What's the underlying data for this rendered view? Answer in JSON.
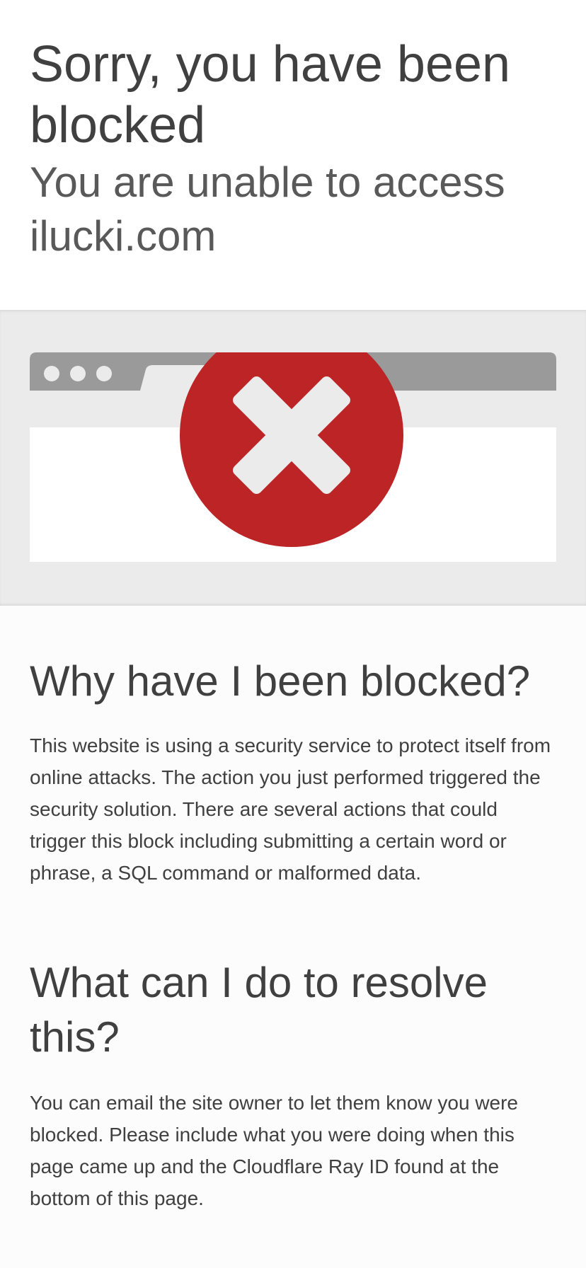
{
  "header": {
    "title": "Sorry, you have been blocked",
    "subtitle": "You are unable to access ilucki.com"
  },
  "illustration": {
    "icon": "error-x-icon",
    "colors": {
      "circle": "#bd2426",
      "browser_bar": "#9a9a9a",
      "band": "#ebebeb"
    }
  },
  "why": {
    "heading": "Why have I been blocked?",
    "text": "This website is using a security service to protect itself from online attacks. The action you just performed triggered the security solution. There are several actions that could trigger this block including submitting a certain word or phrase, a SQL command or malformed data."
  },
  "resolve": {
    "heading": "What can I do to resolve this?",
    "text": "You can email the site owner to let them know you were blocked. Please include what you were doing when this page came up and the Cloudflare Ray ID found at the bottom of this page."
  }
}
